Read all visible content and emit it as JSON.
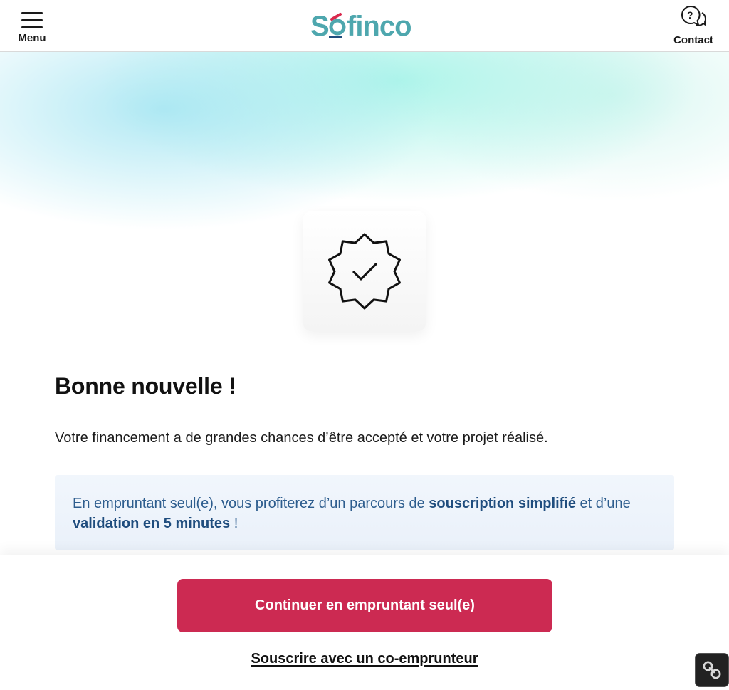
{
  "header": {
    "menu_label": "Menu",
    "contact_label": "Contact",
    "logo_text": "Sofinco"
  },
  "colors": {
    "logo_teal": "#4ea7ae",
    "accent_red": "#cc2a52",
    "info_text": "#2d5d8e"
  },
  "icons": {
    "menu": "hamburger-icon",
    "contact": "question-chat-icon",
    "badge": "verified-badge-icon",
    "extension": "link-chain-icon"
  },
  "main": {
    "heading": "Bonne nouvelle !",
    "lead": "Votre financement a de grandes chances d’être accepté et votre projet réalisé.",
    "info": {
      "part1": "En empruntant seul(e), vous profiterez d’un parcours de ",
      "bold1": "souscription simplifié",
      "part2": " et d’une ",
      "bold2": "validation en 5 minutes",
      "part3": " !"
    }
  },
  "actions": {
    "primary_label": "Continuer en empruntant seul(e)",
    "secondary_label": "Souscrire avec un co-emprunteur"
  }
}
